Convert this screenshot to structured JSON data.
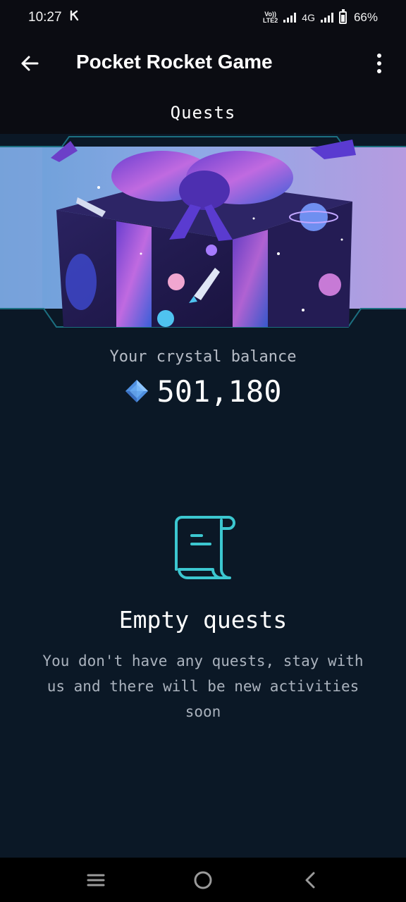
{
  "status_bar": {
    "time": "10:27",
    "carrier_icon": "k-logo-icon",
    "volte_top": "Vo))",
    "volte_bottom": "LTE2",
    "network": "4G",
    "battery": "66%"
  },
  "app_bar": {
    "title": "Pocket Rocket Game",
    "back_icon": "back-arrow-icon",
    "menu_icon": "more-vert-icon"
  },
  "quests": {
    "header": "Quests"
  },
  "balance": {
    "label": "Your crystal balance",
    "value": "501,180",
    "icon": "crystal-icon"
  },
  "empty_state": {
    "icon": "scroll-icon",
    "title": "Empty quests",
    "description": "You don't have any quests, stay with us and there will be new activities soon"
  },
  "nav_bar": {
    "recents_icon": "recents-icon",
    "home_icon": "home-icon",
    "back_icon": "nav-back-icon"
  },
  "colors": {
    "background": "#0b1826",
    "bar": "#0b0c12",
    "accent": "#3cc7d0",
    "crystal": "#5aa6f0"
  }
}
